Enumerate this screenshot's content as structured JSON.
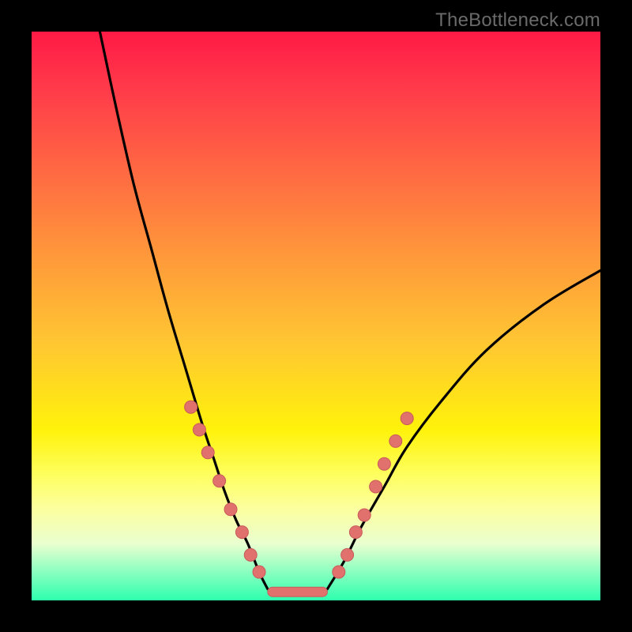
{
  "attribution": "TheBottleneck.com",
  "colors": {
    "page_bg": "#000000",
    "gradient_top": "#ff1a45",
    "gradient_mid": "#fff20a",
    "gradient_bottom": "#2dffae",
    "curve": "#000000",
    "dot_fill": "#e0716c",
    "dot_stroke": "#c95a5a",
    "baseline_fill": "#e0716c"
  },
  "chart_data": {
    "type": "line",
    "title": "",
    "xlabel": "",
    "ylabel": "",
    "xlim": [
      0,
      100
    ],
    "ylim": [
      0,
      100
    ],
    "series": [
      {
        "name": "left-branch",
        "x": [
          12,
          15,
          18,
          21,
          24,
          27,
          30,
          32,
          34,
          36,
          38,
          40,
          41.5
        ],
        "y": [
          100,
          86,
          73,
          62,
          51,
          41,
          31,
          25,
          19,
          14,
          10,
          5,
          2
        ]
      },
      {
        "name": "right-branch",
        "x": [
          52,
          55,
          58,
          62,
          66,
          72,
          80,
          90,
          100
        ],
        "y": [
          2,
          7,
          13,
          20,
          27,
          35,
          44,
          52,
          58
        ]
      },
      {
        "name": "baseline-segment",
        "x": [
          41.5,
          52
        ],
        "y": [
          1.5,
          1.5
        ]
      }
    ],
    "points_left": [
      {
        "x": 28,
        "y": 34
      },
      {
        "x": 29.5,
        "y": 30
      },
      {
        "x": 31,
        "y": 26
      },
      {
        "x": 33,
        "y": 21
      },
      {
        "x": 35,
        "y": 16
      },
      {
        "x": 37,
        "y": 12
      },
      {
        "x": 38.5,
        "y": 8
      },
      {
        "x": 40,
        "y": 5
      }
    ],
    "points_right": [
      {
        "x": 54,
        "y": 5
      },
      {
        "x": 55.5,
        "y": 8
      },
      {
        "x": 57,
        "y": 12
      },
      {
        "x": 58.5,
        "y": 15
      },
      {
        "x": 60.5,
        "y": 20
      },
      {
        "x": 62,
        "y": 24
      },
      {
        "x": 64,
        "y": 28
      },
      {
        "x": 66,
        "y": 32
      }
    ]
  }
}
